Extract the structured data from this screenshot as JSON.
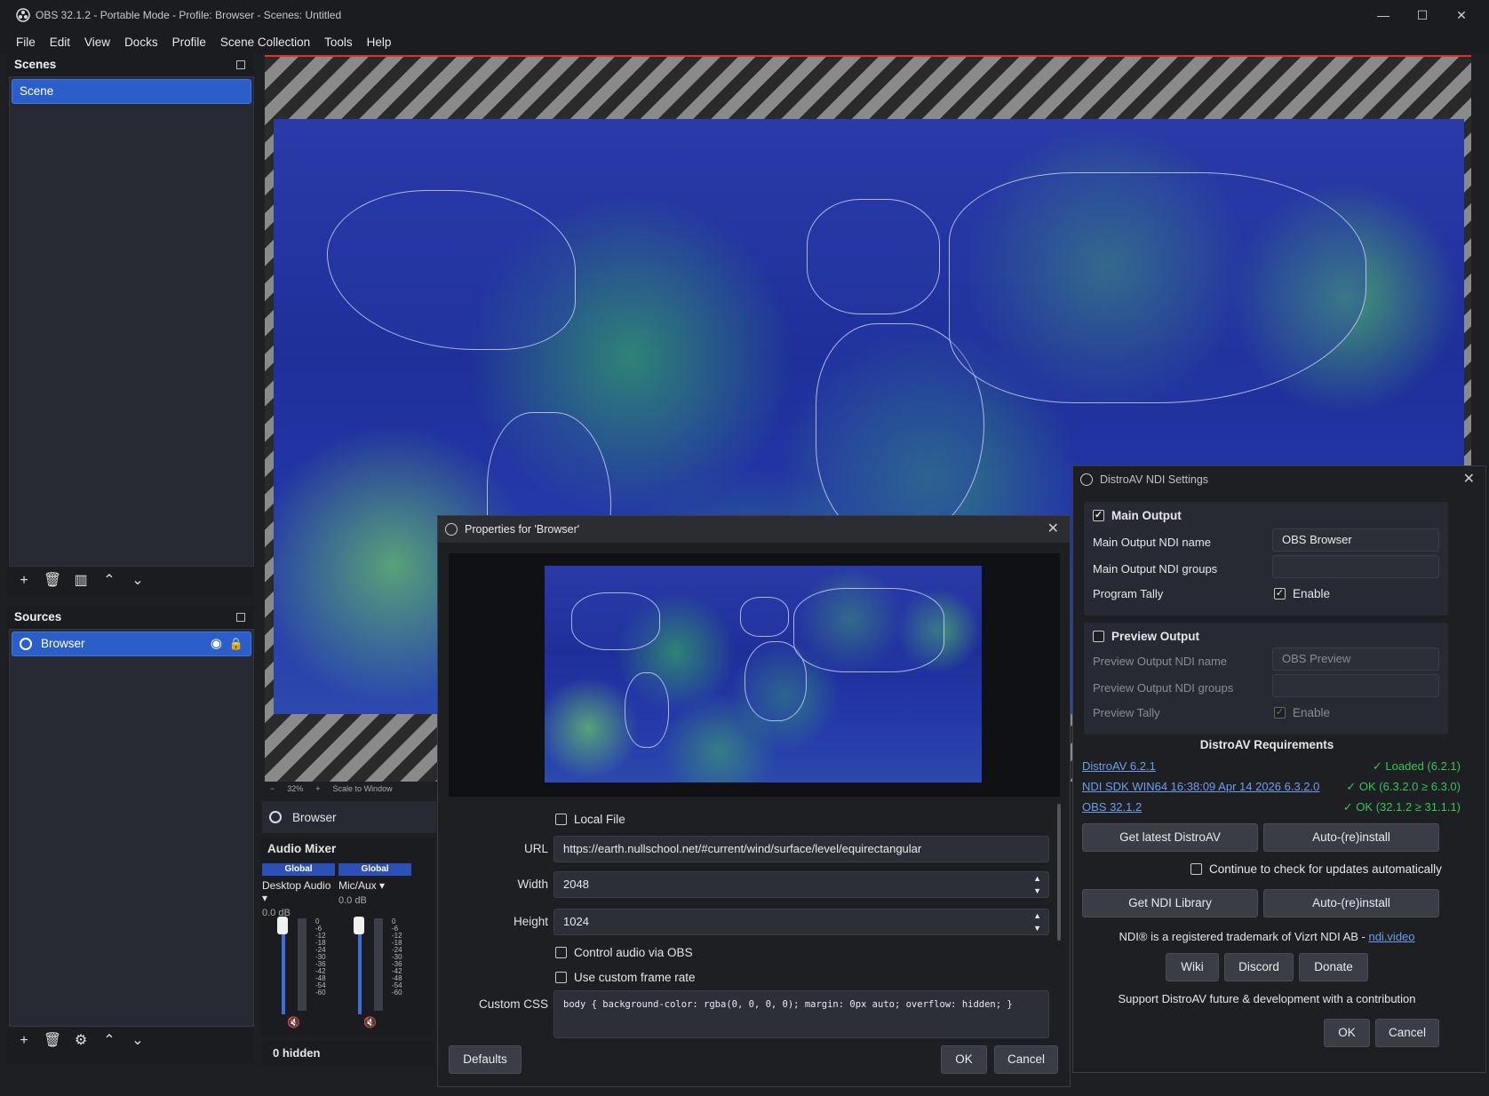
{
  "window": {
    "title": "OBS 32.1.2 - Portable Mode - Profile: Browser - Scenes: Untitled"
  },
  "menu": [
    "File",
    "Edit",
    "View",
    "Docks",
    "Profile",
    "Scene Collection",
    "Tools",
    "Help"
  ],
  "scenes": {
    "title": "Scenes",
    "items": [
      "Scene"
    ]
  },
  "sources": {
    "title": "Sources",
    "items": [
      "Browser"
    ],
    "hidden": "0 hidden"
  },
  "preview_bar": {
    "zoom": "32%",
    "scale": "Scale to Window"
  },
  "source_bar": {
    "name": "Browser"
  },
  "mixer": {
    "title": "Audio Mixer",
    "channels": [
      {
        "badge": "Global",
        "name": "Desktop Audio",
        "db": "0.0 dB"
      },
      {
        "badge": "Global",
        "name": "Mic/Aux",
        "db": "0.0 dB"
      }
    ],
    "scale": "0\n-6\n-12\n-18\n-24\n-30\n-36\n-42\n-48\n-54\n-60"
  },
  "properties": {
    "title": "Properties for 'Browser'",
    "local_file": "Local File",
    "url_label": "URL",
    "url": "https://earth.nullschool.net/#current/wind/surface/level/equirectangular",
    "width_label": "Width",
    "width": "2048",
    "height_label": "Height",
    "height": "1024",
    "control_audio": "Control audio via OBS",
    "custom_fps": "Use custom frame rate",
    "css_label": "Custom CSS",
    "css": "body { background-color: rgba(0, 0, 0, 0); margin: 0px auto; overflow: hidden; }",
    "defaults": "Defaults",
    "ok": "OK",
    "cancel": "Cancel"
  },
  "ndi": {
    "title": "DistroAV NDI Settings",
    "main_output": "Main Output",
    "main_name_label": "Main Output NDI name",
    "main_name": "OBS Browser",
    "main_groups_label": "Main Output NDI groups",
    "main_groups": "",
    "program_tally": "Program Tally",
    "enable": "Enable",
    "preview_output": "Preview Output",
    "preview_name_label": "Preview Output NDI name",
    "preview_name": "OBS Preview",
    "preview_groups_label": "Preview Output NDI groups",
    "preview_tally": "Preview Tally",
    "req_title": "DistroAV Requirements",
    "reqs": [
      {
        "name": "DistroAV 6.2.1",
        "status": "✓ Loaded (6.2.1)"
      },
      {
        "name": "NDI SDK WIN64 16:38:09 Apr 14 2026 6.3.2.0",
        "status": "✓ OK (6.3.2.0 ≥ 6.3.0)"
      },
      {
        "name": "OBS 32.1.2",
        "status": "✓ OK (32.1.2 ≥ 31.1.1)"
      }
    ],
    "get_distroav": "Get latest DistroAV",
    "auto_reinstall": "Auto-(re)install",
    "check_updates": "Continue to check for updates automatically",
    "get_ndi": "Get NDI Library",
    "trademark": "NDI® is a registered trademark of Vizrt NDI AB - ",
    "ndi_link": "ndi.video",
    "wiki": "Wiki",
    "discord": "Discord",
    "donate": "Donate",
    "support": "Support DistroAV future & development with a contribution",
    "ok": "OK",
    "cancel": "Cancel"
  }
}
